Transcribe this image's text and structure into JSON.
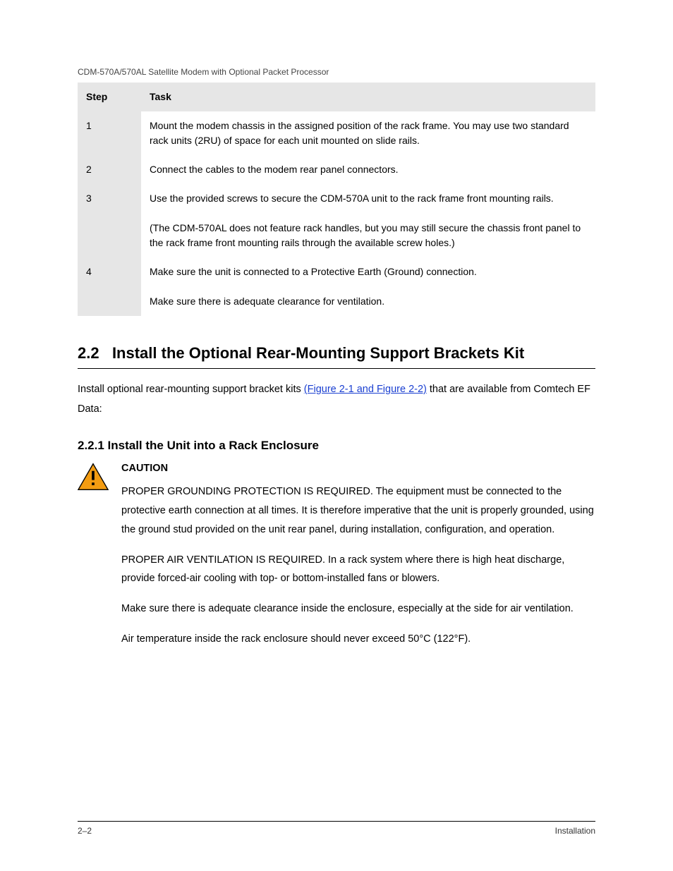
{
  "header": {
    "breadcrumb": "CDM-570A/570AL Satellite Modem with Optional Packet Processor"
  },
  "table": {
    "head": {
      "c0": "Step",
      "c1": "Task"
    },
    "rows": [
      {
        "step": "1",
        "task": "Mount the modem chassis in the assigned position of the rack frame. You may use two standard rack units (2RU) of space for each unit mounted on slide rails."
      },
      {
        "step": "2",
        "task": "Connect the cables to the modem rear panel connectors."
      },
      {
        "step": "3",
        "task": "Use the provided screws to secure the CDM-570A unit to the rack frame front mounting rails.\n\n(The CDM-570AL does not feature rack handles, but you may still secure the chassis front panel to the rack frame front mounting rails through the available screw holes.)"
      },
      {
        "step": "4",
        "task": "Make sure the unit is connected to a Protective Earth (Ground) connection.\n\nMake sure there is adequate clearance for ventilation."
      }
    ]
  },
  "section": {
    "num": "2.2",
    "title": "Install the Optional Rear-Mounting Support Brackets Kit",
    "intro": "Install optional rear-mounting support bracket kits ",
    "link": "(Figure 2-1 and Figure 2-2)",
    "tail": " that are available from Comtech EF Data:"
  },
  "subhead": "2.2.1  Install the Unit into a Rack Enclosure",
  "caution": {
    "label": "CAUTION",
    "p1": "PROPER GROUNDING PROTECTION IS REQUIRED. The equipment must be connected to the protective earth connection at all times. It is therefore imperative that the unit is properly grounded, using the ground stud provided on the unit rear panel, during installation, configuration, and operation.",
    "p2": "PROPER AIR VENTILATION IS REQUIRED. In a rack system where there is high heat discharge, provide forced-air cooling with top- or bottom-installed fans or blowers.",
    "p3": "Make sure there is adequate clearance inside the enclosure, especially at the side for air ventilation.",
    "p4": "Air temperature inside the rack enclosure should never exceed 50°C (122°F)."
  },
  "footer": {
    "left": "2–2",
    "right": "Installation"
  }
}
